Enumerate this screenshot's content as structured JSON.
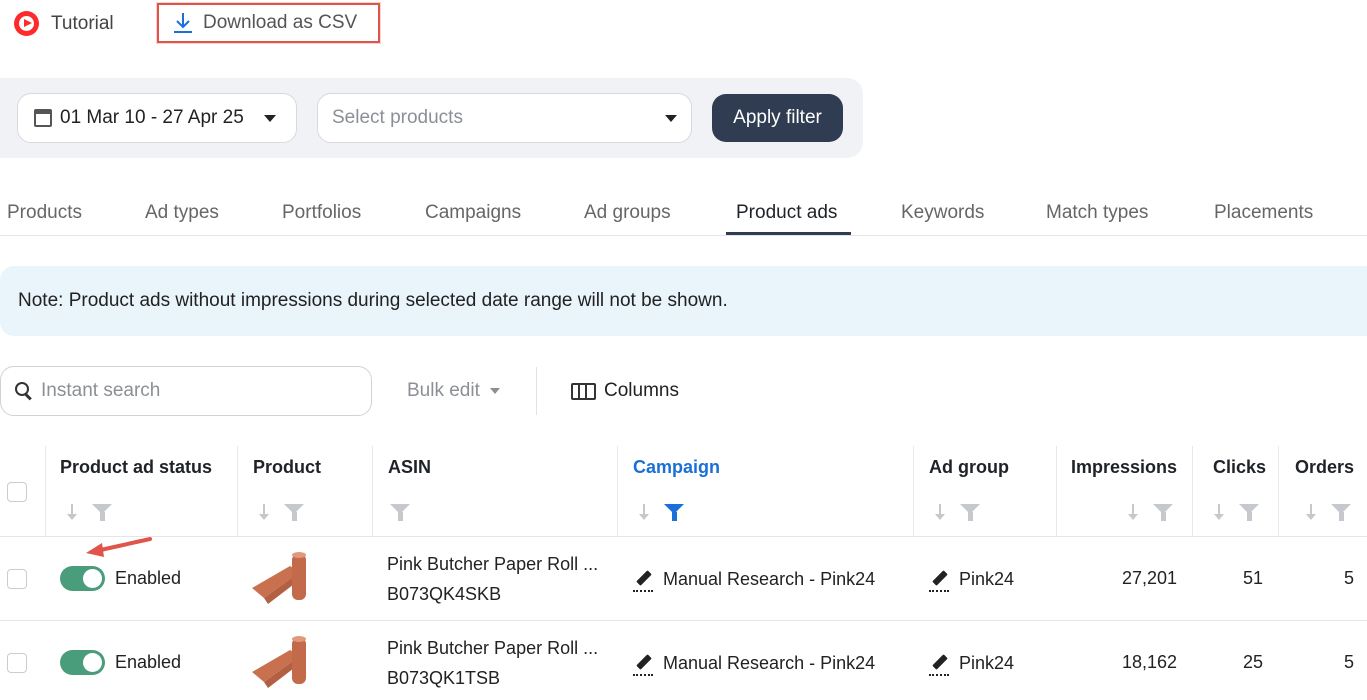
{
  "topbar": {
    "tutorial_label": "Tutorial",
    "download_label": "Download as CSV"
  },
  "filter": {
    "date_range": "01 Mar 10 - 27 Apr 25",
    "products_placeholder": "Select products",
    "apply_label": "Apply filter"
  },
  "tabs": [
    {
      "label": "Products"
    },
    {
      "label": "Ad types"
    },
    {
      "label": "Portfolios"
    },
    {
      "label": "Campaigns"
    },
    {
      "label": "Ad groups"
    },
    {
      "label": "Product ads",
      "active": true
    },
    {
      "label": "Keywords"
    },
    {
      "label": "Match types"
    },
    {
      "label": "Placements"
    }
  ],
  "note": "Note: Product ads without impressions during selected date range will not be shown.",
  "toolbar": {
    "search_placeholder": "Instant search",
    "bulk_edit_label": "Bulk edit",
    "columns_label": "Columns"
  },
  "table": {
    "headers": {
      "status": "Product ad status",
      "product": "Product",
      "asin": "ASIN",
      "campaign": "Campaign",
      "ad_group": "Ad group",
      "impressions": "Impressions",
      "clicks": "Clicks",
      "orders": "Orders"
    },
    "rows": [
      {
        "status": "Enabled",
        "title": "Pink Butcher Paper Roll ...",
        "asin": "B073QK4SKB",
        "campaign": "Manual Research - Pink24",
        "ad_group": "Pink24",
        "impressions": "27,201",
        "clicks": "51",
        "orders": "5"
      },
      {
        "status": "Enabled",
        "title": "Pink Butcher Paper Roll ...",
        "asin": "B073QK1TSB",
        "campaign": "Manual Research - Pink24",
        "ad_group": "Pink24",
        "impressions": "18,162",
        "clicks": "25",
        "orders": "5"
      }
    ]
  },
  "colors": {
    "accent_dark": "#2f3c52",
    "link_blue": "#1a6fd8",
    "toggle_green": "#4a9d7a",
    "highlight_red": "#e0554b",
    "note_bg": "#e9f4fb"
  }
}
